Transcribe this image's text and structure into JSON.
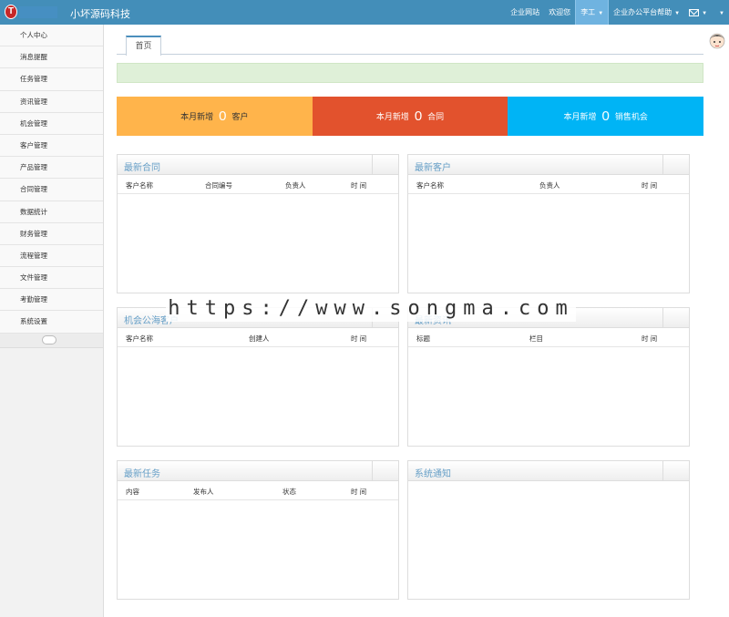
{
  "header": {
    "logo_letter": "T",
    "app_title": "小坏源码科技",
    "nav": {
      "site_link": "企业网站",
      "welcome": "欢迎您",
      "user_name": "李工",
      "help": "企业办公平台帮助"
    }
  },
  "sidebar": {
    "items": [
      {
        "label": "个人中心"
      },
      {
        "label": "消息提醒"
      },
      {
        "label": "任务管理"
      },
      {
        "label": "资讯管理"
      },
      {
        "label": "机会管理"
      },
      {
        "label": "客户管理"
      },
      {
        "label": "产品管理"
      },
      {
        "label": "合同管理"
      },
      {
        "label": "数据统计"
      },
      {
        "label": "财务管理"
      },
      {
        "label": "流程管理"
      },
      {
        "label": "文件管理"
      },
      {
        "label": "考勤管理"
      },
      {
        "label": "系统设置"
      }
    ]
  },
  "tabs": [
    {
      "label": "首页"
    }
  ],
  "stats": [
    {
      "prefix": "本月新增",
      "value": "0",
      "suffix": "客户",
      "color": "#ffb44b"
    },
    {
      "prefix": "本月新增",
      "value": "0",
      "suffix": "合同",
      "color": "#e2522d"
    },
    {
      "prefix": "本月新增",
      "value": "0",
      "suffix": "销售机会",
      "color": "#00b4f5"
    }
  ],
  "panels": {
    "contracts": {
      "title": "最新合同",
      "columns": [
        "客户名称",
        "合同编号",
        "负责人",
        "时 间"
      ]
    },
    "customers": {
      "title": "最新客户",
      "columns": [
        "客户名称",
        "负责人",
        "时 间"
      ]
    },
    "opportunities": {
      "title": "机会公海客户",
      "columns": [
        "客户名称",
        "创建人",
        "时 间"
      ]
    },
    "news": {
      "title": "最新资讯",
      "columns": [
        "标题",
        "栏目",
        "时 间"
      ]
    },
    "tasks": {
      "title": "最新任务",
      "columns": [
        "内容",
        "发布人",
        "状态",
        "时 间"
      ]
    },
    "notices": {
      "title": "系统通知",
      "columns": []
    }
  },
  "watermark": "https://www.songma.com",
  "colors": {
    "header": "#438eb9",
    "accent": "#669fc7",
    "alert": "#dff0d8"
  }
}
